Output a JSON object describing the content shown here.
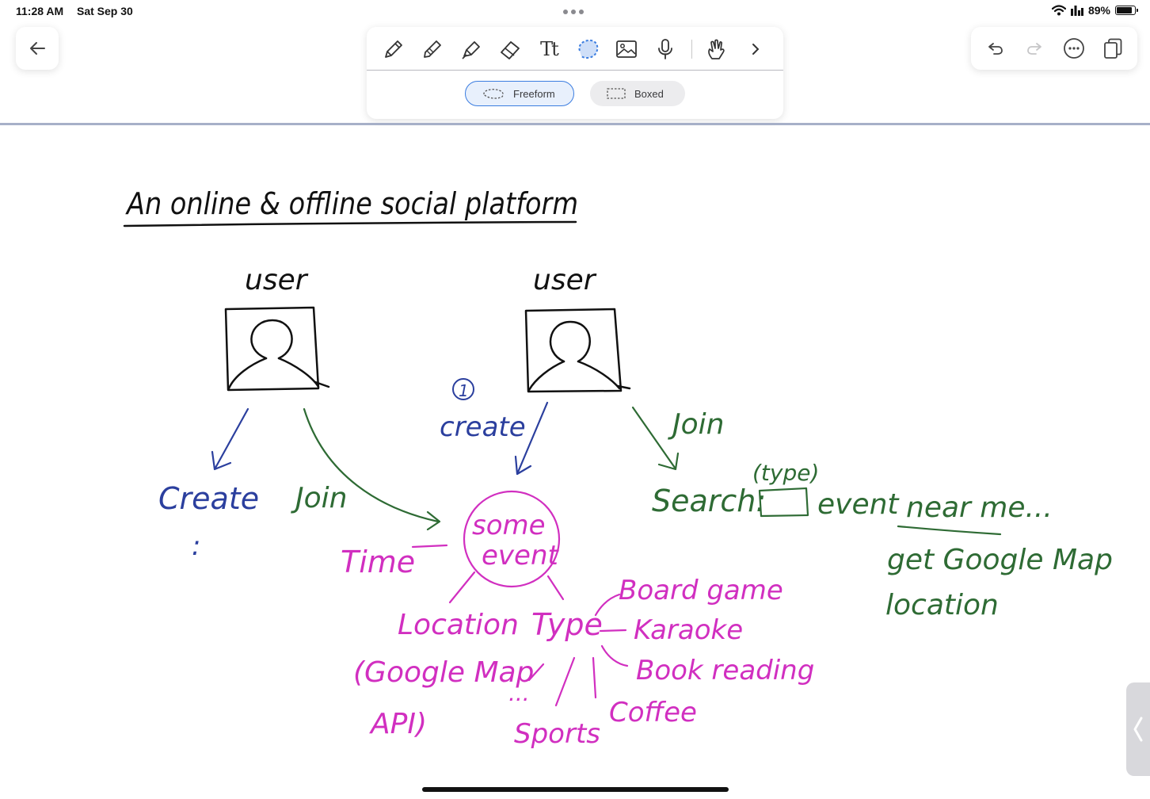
{
  "status_bar": {
    "time": "11:28 AM",
    "date": "Sat Sep 30",
    "battery_percent": "89%",
    "battery_level": 0.89,
    "icons": [
      "wifi-icon",
      "signal-icon",
      "battery-icon"
    ]
  },
  "toolbar": {
    "back_icon": "arrow-left-icon",
    "tools": [
      "pen-icon",
      "pencil-icon",
      "highlighter-icon",
      "eraser-icon",
      "text-icon",
      "lasso-icon",
      "image-icon",
      "microphone-icon",
      "gesture-hand-icon",
      "chevron-right-icon"
    ],
    "selected_tool": "lasso-icon",
    "text_tool_glyph": "Tt",
    "lasso_modes": {
      "freeform_label": "Freeform",
      "boxed_label": "Boxed",
      "selected": "Freeform"
    },
    "accent_color": "#3b7de0"
  },
  "right_toolbar": {
    "icons": [
      "undo-icon",
      "redo-icon",
      "more-icon",
      "pages-icon"
    ]
  },
  "note": {
    "title": "An online & offline social platform",
    "ink_colors": {
      "black": "#111111",
      "blue": "#2b3f9e",
      "green": "#2e6b34",
      "magenta": "#d12fc0"
    },
    "users": [
      "user",
      "user"
    ],
    "step_marker": "1",
    "labels": {
      "create_small": "create",
      "create": "Create",
      "join_left": "Join",
      "join_right": "Join",
      "dots_vertical": ":",
      "some": "some",
      "event": "event",
      "time": "Time",
      "location": "Location",
      "google_map_api_line1": "(Google Map",
      "google_map_api_line2": "API)",
      "type": "Type",
      "board_game": "Board game",
      "karaoke": "Karaoke",
      "book_reading": "Book reading",
      "coffee": "Coffee",
      "sports": "Sports",
      "ellipsis": "...",
      "type_hint": "(type)",
      "search": "Search:",
      "search_event": "event",
      "near_me": "near me...",
      "get_google_map": "get Google Map",
      "location_lower": "location"
    }
  }
}
